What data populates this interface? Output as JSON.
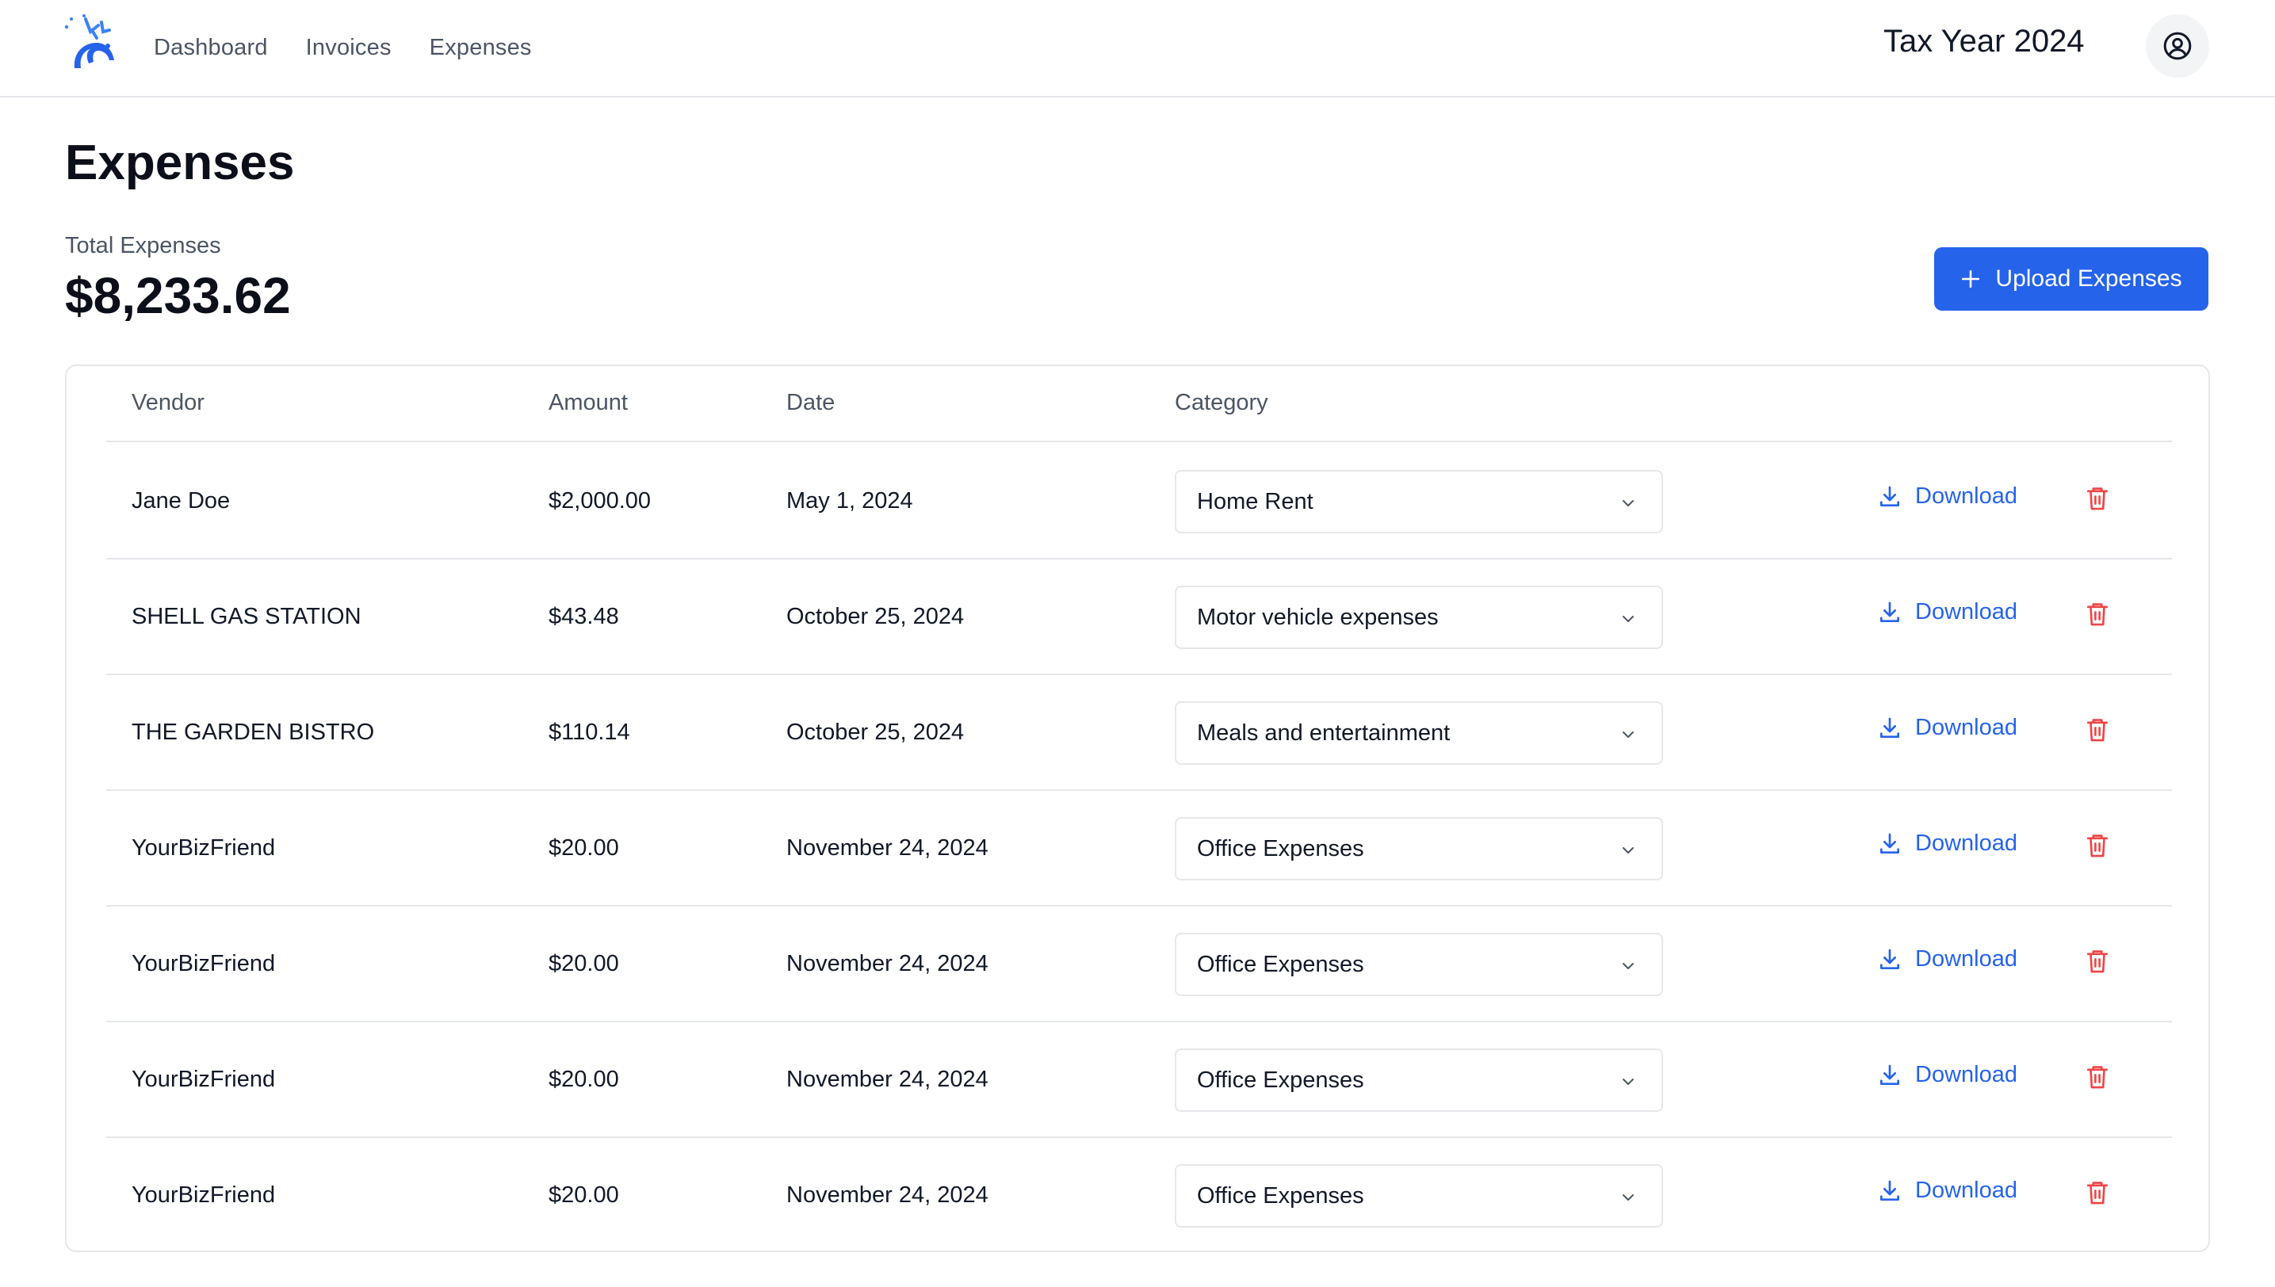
{
  "nav": {
    "items": [
      {
        "label": "Dashboard"
      },
      {
        "label": "Invoices"
      },
      {
        "label": "Expenses"
      }
    ],
    "tax_year": "Tax Year 2024"
  },
  "page": {
    "title": "Expenses",
    "total_label": "Total Expenses",
    "total_value": "$8,233.62",
    "upload_label": "Upload Expenses"
  },
  "table": {
    "headers": {
      "vendor": "Vendor",
      "amount": "Amount",
      "date": "Date",
      "category": "Category"
    },
    "download_label": "Download",
    "rows": [
      {
        "vendor": "Jane Doe",
        "amount": "$2,000.00",
        "date": "May 1, 2024",
        "category": "Home Rent"
      },
      {
        "vendor": "SHELL GAS STATION",
        "amount": "$43.48",
        "date": "October 25, 2024",
        "category": "Motor vehicle expenses"
      },
      {
        "vendor": "THE GARDEN BISTRO",
        "amount": "$110.14",
        "date": "October 25, 2024",
        "category": "Meals and entertainment"
      },
      {
        "vendor": "YourBizFriend",
        "amount": "$20.00",
        "date": "November 24, 2024",
        "category": "Office Expenses"
      },
      {
        "vendor": "YourBizFriend",
        "amount": "$20.00",
        "date": "November 24, 2024",
        "category": "Office Expenses"
      },
      {
        "vendor": "YourBizFriend",
        "amount": "$20.00",
        "date": "November 24, 2024",
        "category": "Office Expenses"
      },
      {
        "vendor": "YourBizFriend",
        "amount": "$20.00",
        "date": "November 24, 2024",
        "category": "Office Expenses"
      }
    ]
  },
  "colors": {
    "accent": "#2563eb",
    "danger": "#ef4444",
    "border": "#e5e7eb",
    "muted": "#4b5563"
  },
  "icons": {
    "logo": "deer-logo-icon",
    "account": "user-circle-icon",
    "upload": "plus-icon",
    "download": "download-icon",
    "delete": "trash-icon",
    "select": "chevron-down-icon"
  }
}
